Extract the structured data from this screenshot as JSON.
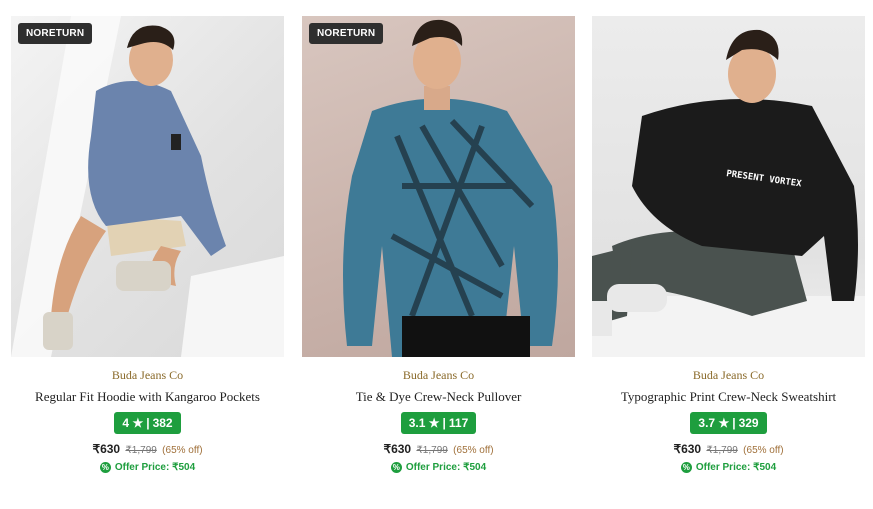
{
  "products": [
    {
      "badge": "NORETURN",
      "brand": "Buda Jeans Co",
      "title": "Regular Fit Hoodie with Kangaroo Pockets",
      "rating": "4",
      "star": "★",
      "reviews": "382",
      "price": "₹630",
      "mrp": "₹1,799",
      "discount": "(65% off)",
      "offer": "Offer Price: ₹504",
      "image_desc": "photo of man in blue hoodie and beige shorts crouching"
    },
    {
      "badge": "NORETURN",
      "brand": "Buda Jeans Co",
      "title": "Tie & Dye Crew-Neck Pullover",
      "rating": "3.1",
      "star": "★",
      "reviews": "117",
      "price": "₹630",
      "mrp": "₹1,799",
      "discount": "(65% off)",
      "offer": "Offer Price: ₹504",
      "image_desc": "photo of man in teal tie-dye sweater"
    },
    {
      "badge": "",
      "brand": "Buda Jeans Co",
      "title": "Typographic Print Crew-Neck Sweatshirt",
      "rating": "3.7",
      "star": "★",
      "reviews": "329",
      "price": "₹630",
      "mrp": "₹1,799",
      "discount": "(65% off)",
      "offer": "Offer Price: ₹504",
      "print_text": "PRESENT VORTEX",
      "image_desc": "photo of man in black sweatshirt sitting"
    }
  ],
  "colors": {
    "rating_bg": "#1e9e3e",
    "brand": "#8a6a2a",
    "badge_bg": "#2f2f2f"
  }
}
